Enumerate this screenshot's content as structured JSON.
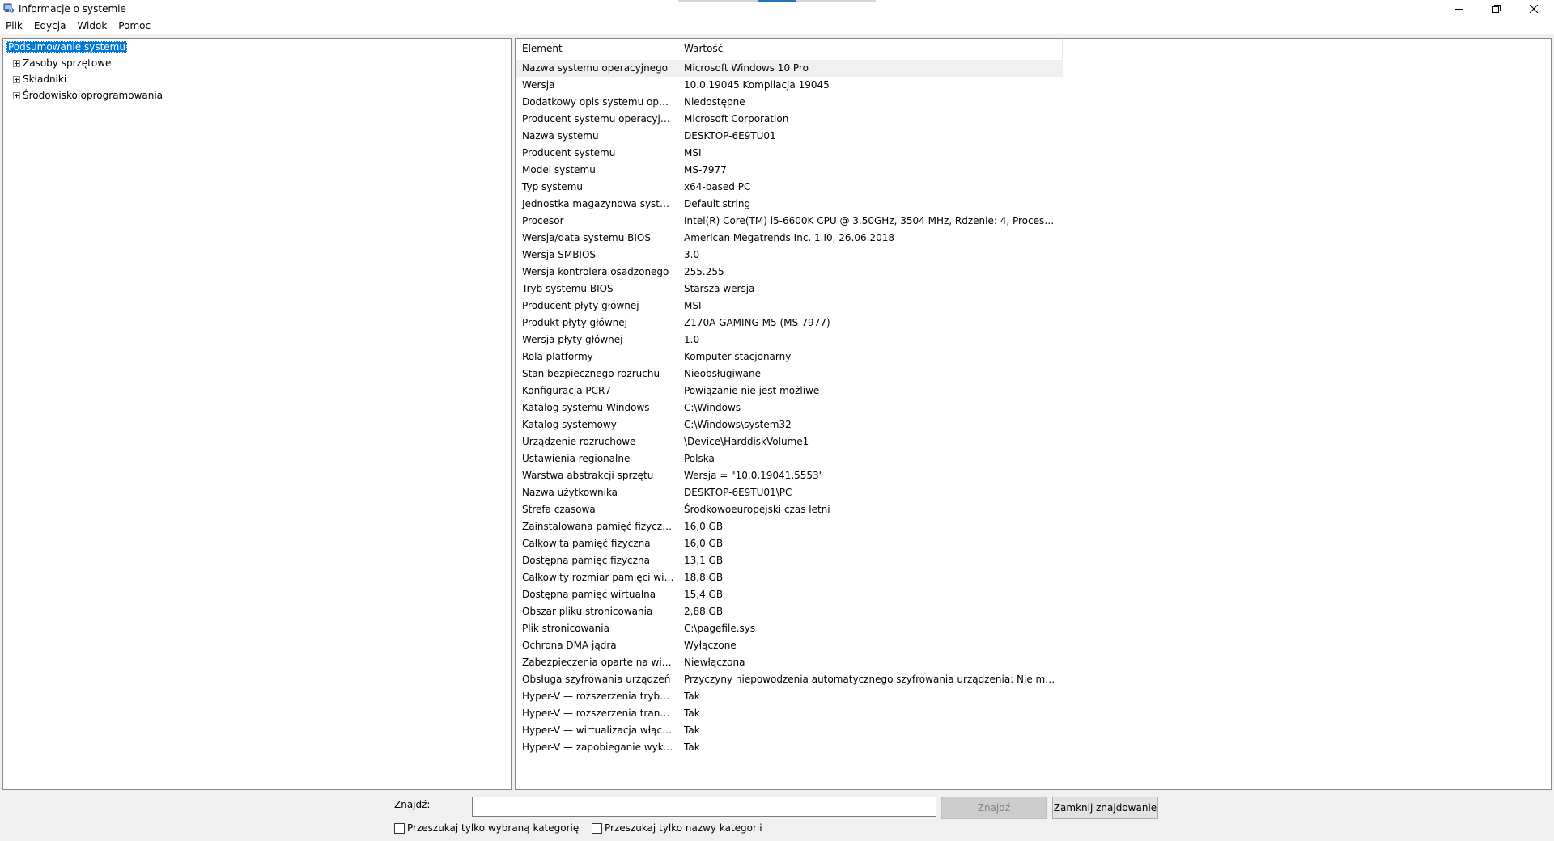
{
  "window": {
    "title": "Informacje o systemie"
  },
  "menu": [
    {
      "label": "Plik"
    },
    {
      "label": "Edycja"
    },
    {
      "label": "Widok"
    },
    {
      "label": "Pomoc"
    }
  ],
  "tree": [
    {
      "label": "Podsumowanie systemu",
      "selected": true,
      "expandable": false
    },
    {
      "label": "Zasoby sprzętowe",
      "selected": false,
      "expandable": true
    },
    {
      "label": "Składniki",
      "selected": false,
      "expandable": true
    },
    {
      "label": "Środowisko oprogramowania",
      "selected": false,
      "expandable": true
    }
  ],
  "details": {
    "columns": [
      "Element",
      "Wartość"
    ],
    "rows": [
      [
        "Nazwa systemu operacyjnego",
        "Microsoft Windows 10 Pro"
      ],
      [
        "Wersja",
        "10.0.19045 Kompilacja 19045"
      ],
      [
        "Dodatkowy opis systemu oper...",
        "Niedostępne"
      ],
      [
        "Producent systemu operacyjne...",
        "Microsoft Corporation"
      ],
      [
        "Nazwa systemu",
        "DESKTOP-6E9TU01"
      ],
      [
        "Producent systemu",
        "MSI"
      ],
      [
        "Model systemu",
        "MS-7977"
      ],
      [
        "Typ systemu",
        "x64-based PC"
      ],
      [
        "Jednostka magazynowa systemu",
        "Default string"
      ],
      [
        "Procesor",
        "Intel(R) Core(TM) i5-6600K CPU @ 3.50GHz, 3504 MHz, Rdzenie: 4, Procesory ..."
      ],
      [
        "Wersja/data systemu BIOS",
        "American Megatrends Inc. 1.I0, 26.06.2018"
      ],
      [
        "Wersja SMBIOS",
        "3.0"
      ],
      [
        "Wersja kontrolera osadzonego",
        "255.255"
      ],
      [
        "Tryb systemu BIOS",
        "Starsza wersja"
      ],
      [
        "Producent płyty głównej",
        "MSI"
      ],
      [
        "Produkt płyty głównej",
        "Z170A GAMING M5 (MS-7977)"
      ],
      [
        "Wersja płyty głównej",
        "1.0"
      ],
      [
        "Rola platformy",
        "Komputer stacjonarny"
      ],
      [
        "Stan bezpiecznego rozruchu",
        "Nieobsługiwane"
      ],
      [
        "Konfiguracja PCR7",
        "Powiązanie nie jest możliwe"
      ],
      [
        "Katalog systemu Windows",
        "C:\\Windows"
      ],
      [
        "Katalog systemowy",
        "C:\\Windows\\system32"
      ],
      [
        "Urządzenie rozruchowe",
        "\\Device\\HarddiskVolume1"
      ],
      [
        "Ustawienia regionalne",
        "Polska"
      ],
      [
        "Warstwa abstrakcji sprzętu",
        "Wersja = \"10.0.19041.5553\""
      ],
      [
        "Nazwa użytkownika",
        "DESKTOP-6E9TU01\\PC"
      ],
      [
        "Strefa czasowa",
        "Środkowoeuropejski czas letni"
      ],
      [
        "Zainstalowana pamięć fizyczna ...",
        "16,0 GB"
      ],
      [
        "Całkowita pamięć fizyczna",
        "16,0 GB"
      ],
      [
        "Dostępna pamięć fizyczna",
        "13,1 GB"
      ],
      [
        "Całkowity rozmiar pamięci wirt...",
        "18,8 GB"
      ],
      [
        "Dostępna pamięć wirtualna",
        "15,4 GB"
      ],
      [
        "Obszar pliku stronicowania",
        "2,88 GB"
      ],
      [
        "Plik stronicowania",
        "C:\\pagefile.sys"
      ],
      [
        "Ochrona DMA jądra",
        "Wyłączone"
      ],
      [
        "Zabezpieczenia oparte na wirtu...",
        "Niewłączona"
      ],
      [
        "Obsługa szyfrowania urządzeń",
        "Przyczyny niepowodzenia automatycznego szyfrowania urządzenia: Nie możn..."
      ],
      [
        "Hyper-V — rozszerzenia trybu ...",
        "Tak"
      ],
      [
        "Hyper-V — rozszerzenia transl...",
        "Tak"
      ],
      [
        "Hyper-V — wirtualizacja włączo...",
        "Tak"
      ],
      [
        "Hyper-V — zapobieganie wyko...",
        "Tak"
      ]
    ]
  },
  "find": {
    "label": "Znajdź:",
    "input_value": "",
    "find_button": "Znajdź",
    "close_button": "Zamknij znajdowanie",
    "checkbox_selected_category": "Przeszukaj tylko wybraną kategorię",
    "checkbox_category_names": "Przeszukaj tylko nazwy kategorii",
    "checkbox_selected_category_checked": false,
    "checkbox_category_names_checked": false
  },
  "colors": {
    "selection": "#0078d7",
    "border": "#828790",
    "background": "#f0f0f0"
  },
  "icons": {
    "app": "system-info-icon",
    "minimize": "minimize-icon",
    "maximize": "restore-icon",
    "close": "close-icon",
    "expander": "plus-box-icon"
  }
}
